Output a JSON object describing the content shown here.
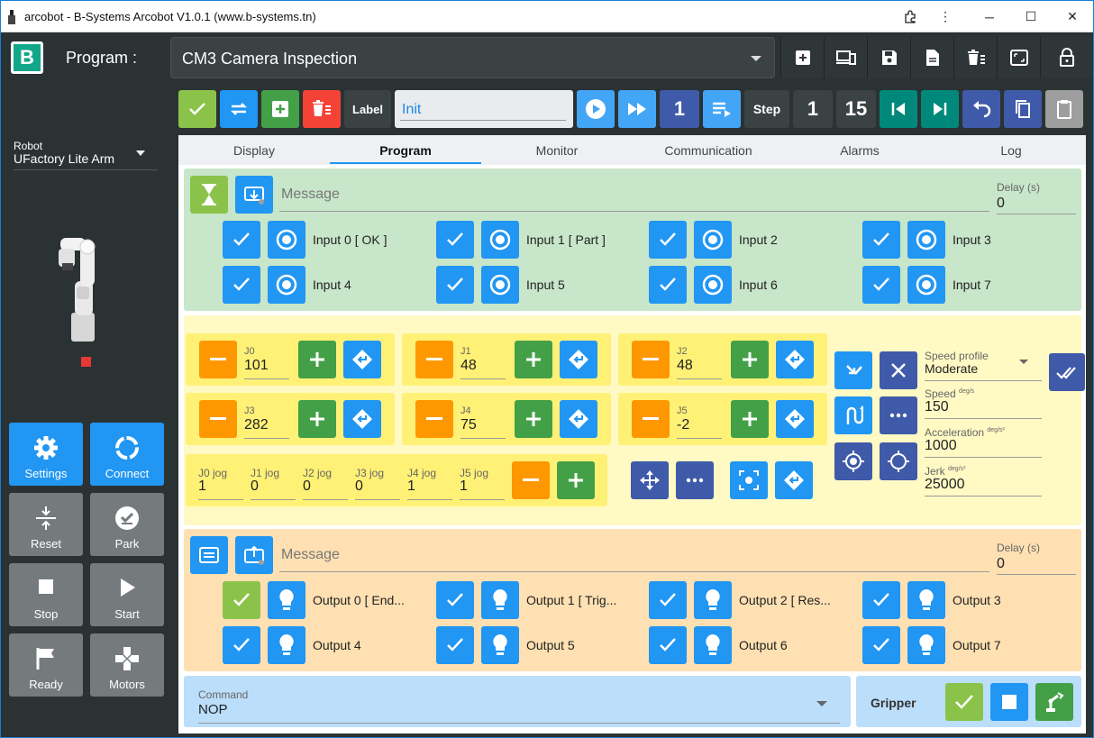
{
  "titlebar": {
    "title": "arcobot - B-Systems Arcobot V1.0.1 (www.b-systems.tn)"
  },
  "header": {
    "logo": "B",
    "program_label": "Program :",
    "program_value": "CM3 Camera Inspection"
  },
  "sidebar": {
    "robot_label": "Robot",
    "robot_value": "UFactory Lite Arm",
    "buttons": {
      "settings": "Settings",
      "connect": "Connect",
      "reset": "Reset",
      "park": "Park",
      "stop": "Stop",
      "start": "Start",
      "ready": "Ready",
      "motors": "Motors"
    }
  },
  "toolbar": {
    "label_button": "Label",
    "label_value": "Init",
    "speed_value": "1",
    "step_label": "Step",
    "step_current": "1",
    "step_total": "15"
  },
  "tabs": [
    "Display",
    "Program",
    "Monitor",
    "Communication",
    "Alarms",
    "Log"
  ],
  "wait": {
    "message_placeholder": "Message",
    "delay_label": "Delay (s)",
    "delay_value": "0",
    "inputs": [
      "Input 0 [ OK ]",
      "Input 1 [ Part ]",
      "Input 2",
      "Input 3",
      "Input 4",
      "Input 5",
      "Input 6",
      "Input 7"
    ]
  },
  "joints": {
    "j0": {
      "label": "J0",
      "value": "101"
    },
    "j1": {
      "label": "J1",
      "value": "48"
    },
    "j2": {
      "label": "J2",
      "value": "48"
    },
    "j3": {
      "label": "J3",
      "value": "282"
    },
    "j4": {
      "label": "J4",
      "value": "75"
    },
    "j5": {
      "label": "J5",
      "value": "-2"
    },
    "jog": [
      {
        "label": "J0 jog",
        "value": "1"
      },
      {
        "label": "J1 jog",
        "value": "0"
      },
      {
        "label": "J2 jog",
        "value": "0"
      },
      {
        "label": "J3 jog",
        "value": "0"
      },
      {
        "label": "J4 jog",
        "value": "1"
      },
      {
        "label": "J5 jog",
        "value": "1"
      }
    ]
  },
  "motion": {
    "speed_profile_label": "Speed profile",
    "speed_profile_value": "Moderate",
    "speed_label": "Speed",
    "speed_unit": "deg/s",
    "speed_value": "150",
    "accel_label": "Acceleration",
    "accel_unit": "deg/s²",
    "accel_value": "1000",
    "jerk_label": "Jerk",
    "jerk_unit": "deg/s³",
    "jerk_value": "25000"
  },
  "outputs": {
    "message_placeholder": "Message",
    "delay_label": "Delay (s)",
    "delay_value": "0",
    "items": [
      "Output 0 [ End...",
      "Output 1 [ Trig...",
      "Output 2 [ Res...",
      "Output 3",
      "Output 4",
      "Output 5",
      "Output 6",
      "Output 7"
    ]
  },
  "command": {
    "label": "Command",
    "value": "NOP"
  },
  "gripper": {
    "label": "Gripper"
  },
  "colors": {
    "blue": "#2196f3",
    "green": "#43a047",
    "orange": "#ff9800",
    "red": "#f44336",
    "dark": "#2b3234",
    "wait_bg": "#c8e6c9",
    "move_bg": "#fff9c4",
    "output_bg": "#ffe0b2",
    "command_bg": "#bbdefb"
  }
}
